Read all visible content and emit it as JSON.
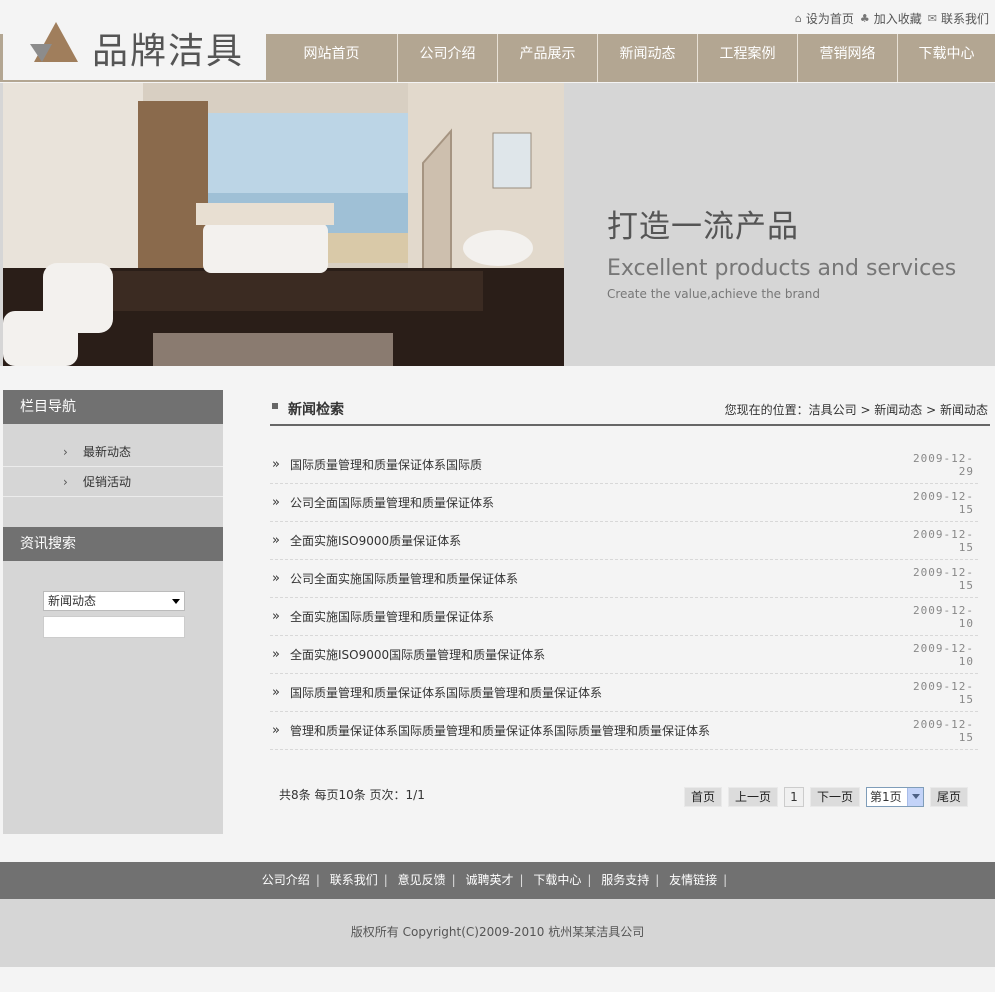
{
  "header": {
    "brand": "品牌洁具",
    "toplinks": [
      {
        "label": "设为首页",
        "icon": "home-icon"
      },
      {
        "label": "加入收藏",
        "icon": "favorites-icon"
      },
      {
        "label": "联系我们",
        "icon": "contact-icon"
      }
    ],
    "nav": [
      "网站首页",
      "公司介绍",
      "产品展示",
      "新闻动态",
      "工程案例",
      "营销网络",
      "下载中心"
    ]
  },
  "banner": {
    "title_cn": "打造一流产品",
    "title_en": "Excellent products and services",
    "subtitle": "Create the value,achieve the brand"
  },
  "sidebar": {
    "nav_title": "栏目导航",
    "nav_items": [
      "最新动态",
      "促销活动"
    ],
    "search_title": "资讯搜索",
    "search_select": "新闻动态",
    "search_keyword": ""
  },
  "main": {
    "title": "新闻检索",
    "breadcrumb": "您现在的位置：洁具公司 > 新闻动态 > 新闻动态",
    "news": [
      {
        "title": "国际质量管理和质量保证体系国际质",
        "date": "2009-12-29"
      },
      {
        "title": "公司全面国际质量管理和质量保证体系",
        "date": "2009-12-15"
      },
      {
        "title": "全面实施ISO9000质量保证体系",
        "date": "2009-12-15"
      },
      {
        "title": "公司全面实施国际质量管理和质量保证体系",
        "date": "2009-12-15"
      },
      {
        "title": "全面实施国际质量管理和质量保证体系",
        "date": "2009-12-10"
      },
      {
        "title": "全面实施ISO9000国际质量管理和质量保证体系",
        "date": "2009-12-10"
      },
      {
        "title": "国际质量管理和质量保证体系国际质量管理和质量保证体系",
        "date": "2009-12-15"
      },
      {
        "title": "管理和质量保证体系国际质量管理和质量保证体系国际质量管理和质量保证体系",
        "date": "2009-12-15"
      }
    ],
    "pager": {
      "info": "共8条  每页10条  页次：1/1",
      "first": "首页",
      "prev": "上一页",
      "current": "1",
      "next": "下一页",
      "select": "第1页",
      "last": "尾页"
    }
  },
  "footer": {
    "links": [
      "公司介绍",
      "联系我们",
      "意见反馈",
      "诚聘英才",
      "下载中心",
      "服务支持",
      "友情链接"
    ],
    "copyright": "版权所有  Copyright(C)2009-2010 杭州某某洁具公司"
  },
  "colors": {
    "accent": "#b3a692",
    "dark_bar": "#717171",
    "panel": "#d6d6d6",
    "background": "#f4f4f4"
  }
}
